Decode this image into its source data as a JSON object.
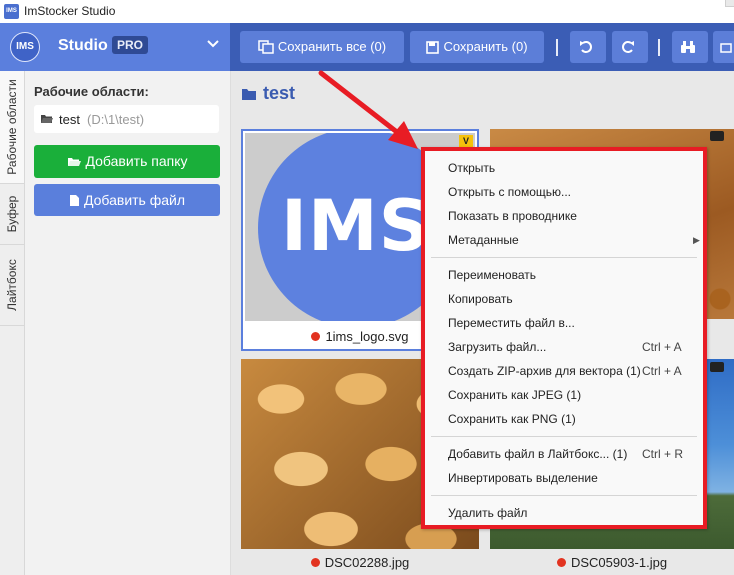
{
  "window": {
    "title": "ImStocker Studio",
    "app_icon_text": "IMS"
  },
  "brand": {
    "logo_text": "IMS",
    "name": "Studio",
    "badge": "PRO"
  },
  "toolbar": {
    "save_all_label": "Сохранить все (0)",
    "save_label": "Сохранить (0)"
  },
  "vtabs": [
    "Рабочие области",
    "Буфер",
    "Лайтбокс"
  ],
  "sidebar": {
    "title": "Рабочие области:",
    "workspace_name": "test",
    "workspace_path": "(D:\\1\\test)",
    "add_folder_label": "Добавить папку",
    "add_file_label": "Добавить файл"
  },
  "main": {
    "folder_title": "test",
    "files": [
      {
        "name": "1ims_logo.svg",
        "status_color": "#e23320",
        "badge": "V"
      },
      {
        "name": "DSC02288.jpg",
        "status_color": "#e23320"
      },
      {
        "name": "DSC05903-1.jpg",
        "status_color": "#e23320"
      }
    ],
    "logo_preview_text": "IMS"
  },
  "context_menu": {
    "items": [
      {
        "label": "Открыть"
      },
      {
        "label": "Открыть с помощью..."
      },
      {
        "label": "Показать в проводнике"
      },
      {
        "label": "Метаданные",
        "submenu": true
      },
      {
        "label": "Переименовать"
      },
      {
        "label": "Копировать"
      },
      {
        "label": "Переместить файл в..."
      },
      {
        "label": "Загрузить файл...",
        "shortcut": "Ctrl + A"
      },
      {
        "label": "Создать ZIP-архив для вектора (1)",
        "shortcut": "Ctrl + A"
      },
      {
        "label": "Сохранить как JPEG (1)"
      },
      {
        "label": "Сохранить как PNG (1)"
      },
      {
        "label": "Добавить файл в Лайтбокс... (1)",
        "shortcut": "Ctrl + R"
      },
      {
        "label": "Инвертировать выделение"
      },
      {
        "label": "Удалить файл"
      }
    ]
  },
  "colors": {
    "accent": "#5b7fdd",
    "toolbar": "#3b5db5",
    "green": "#1aaf3a",
    "highlight_border": "#e81c24"
  }
}
